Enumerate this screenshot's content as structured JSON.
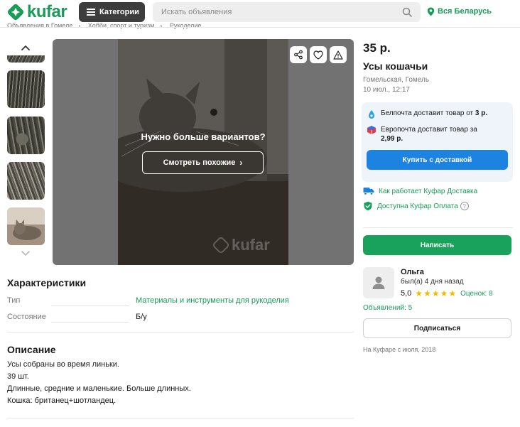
{
  "header": {
    "logo_text": "kufar",
    "categories_label": "Категории",
    "search_placeholder": "Искать объявления",
    "region_label": "Вся Беларусь",
    "brand_color": "#199c57"
  },
  "breadcrumb": [
    "Объявления в Гомеле",
    "Хобби, спорт и туризм",
    "Рукоделие"
  ],
  "gallery": {
    "overlay_title": "Нужно больше вариантов?",
    "overlay_button": "Смотреть похожие",
    "watermark": "kufar"
  },
  "listing": {
    "price": "35 р.",
    "title": "Усы кошачьи",
    "location": "Гомельская, Гомель",
    "date": "10 июл., 12:17"
  },
  "delivery": {
    "belpochta_prefix": "Белпочта доставит товар от ",
    "belpochta_price": "3 р.",
    "europochta_prefix": "Европочта доставит товар за ",
    "europochta_price": "2,99 р.",
    "buy_button": "Купить с доставкой",
    "how_it_works": "Как работает Куфар Доставка",
    "payment": "Доступна Куфар Оплата",
    "help_mark": "?"
  },
  "contact": {
    "write_button": "Написать"
  },
  "seller": {
    "name": "Ольга",
    "last_seen": "был(а) 4 дня назад",
    "rating": "5,0",
    "stars": 5,
    "reviews": "Оценок: 8",
    "ads_count": "Объявлений: 5",
    "subscribe_button": "Подписаться",
    "since": "На Куфаре с июля, 2018"
  },
  "characteristics": {
    "title": "Характеристики",
    "rows": [
      {
        "label": "Тип",
        "value": "Материалы и инструменты для рукоделия"
      },
      {
        "label": "Состояние",
        "value": "Б/у"
      }
    ]
  },
  "description": {
    "title": "Описание",
    "lines": [
      "Усы собраны во время линьки.",
      "39 шт.",
      "Длинные, средние и маленькие. Больше длинных.",
      "Кошка: британец+шотландец."
    ]
  }
}
